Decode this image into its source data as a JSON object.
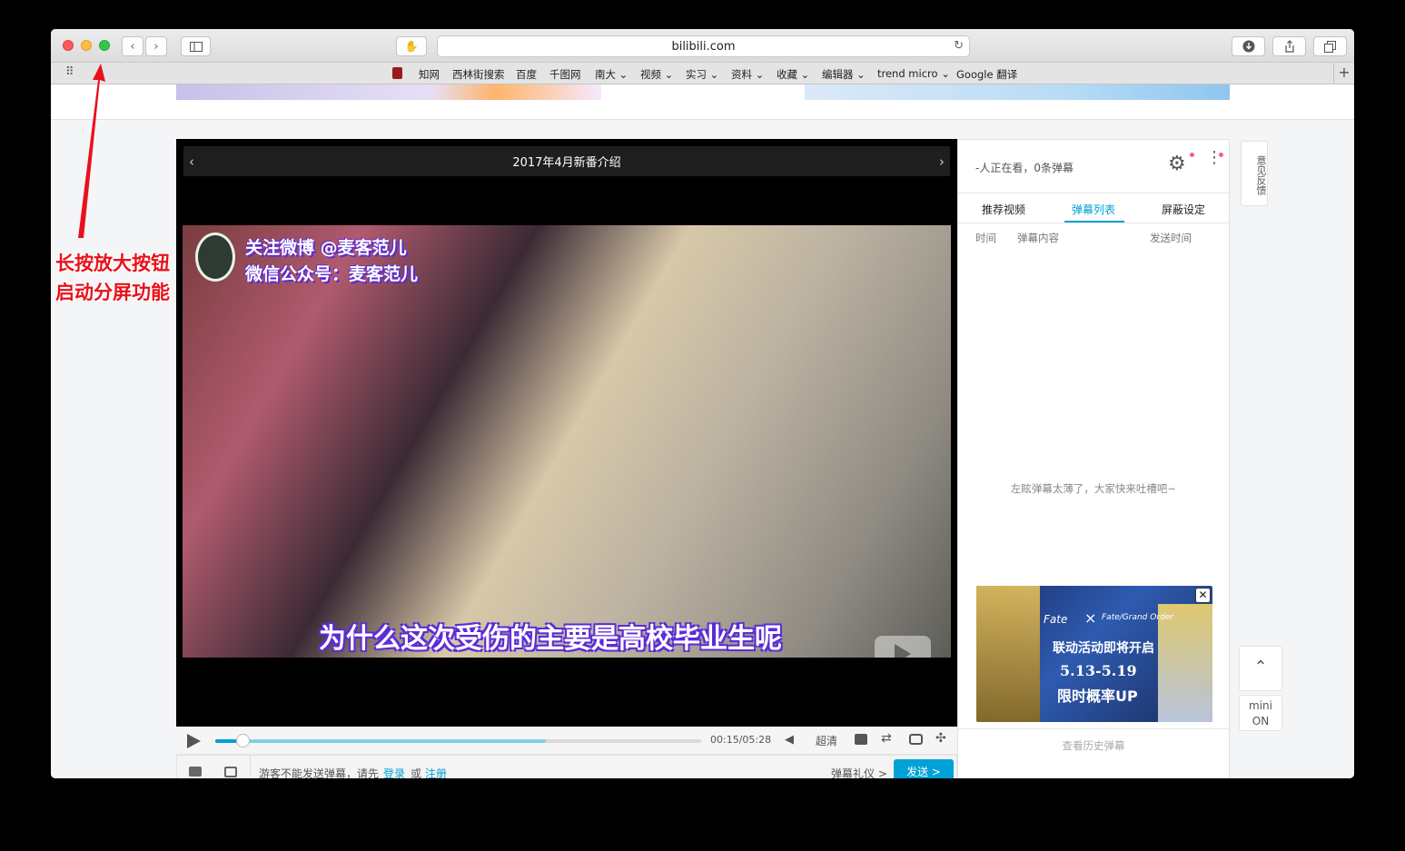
{
  "browser": {
    "url": "bilibili.com",
    "bookmarks": [
      "知网",
      "西林街搜索",
      "百度",
      "千图网",
      "南大 ⌄",
      "视频 ⌄",
      "实习 ⌄",
      "资料 ⌄",
      "收藏 ⌄",
      "编辑器 ⌄",
      "trend micro ⌄",
      "Google 翻译"
    ]
  },
  "annotation": {
    "line1": "长按放大按钮",
    "line2": "启动分屏功能"
  },
  "player": {
    "title": "2017年4月新番介绍",
    "watermark_line1": "关注微博 @麦客范儿",
    "watermark_line2": "微信公众号：麦客范儿",
    "subtitle": "为什么这次受伤的主要是高校毕业生呢",
    "time": "00:15/05:28",
    "quality": "超清",
    "progress": 0.68
  },
  "sendbar": {
    "prompt": "游客不能发送弹幕，请先",
    "login": "登录",
    "or": "或",
    "register": "注册",
    "etiquette": "弹幕礼仪 >",
    "send": "发送 >"
  },
  "danmaku": {
    "viewers": "-人正在看，0条弹幕",
    "tabs": [
      "推荐视频",
      "弹幕列表",
      "屏蔽设定"
    ],
    "columns": [
      "时间",
      "弹幕内容",
      "发送时间"
    ],
    "empty": "左眩弹幕太薄了，大家快来吐槽吧~",
    "history": "查看历史弹幕"
  },
  "ad": {
    "fate_left": "Fate",
    "fate_right": "Fate/Grand Order",
    "headline": "联动活动即将开启",
    "dates": "5.13-5.19",
    "rate": "限时概率UP"
  },
  "feedback": "意见反馈",
  "mini": {
    "line1": "mini",
    "line2": "ON"
  },
  "colors": {
    "accent": "#00a1d6",
    "annotation": "#e8111b"
  }
}
